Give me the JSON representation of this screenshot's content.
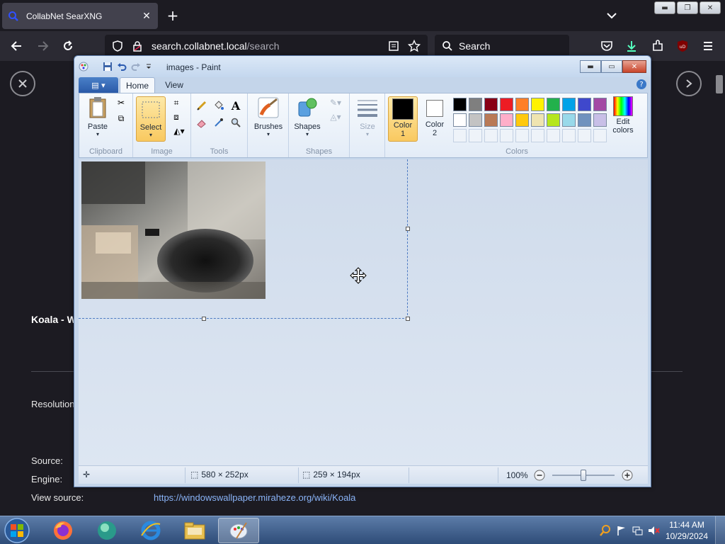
{
  "browser": {
    "tab_title": "CollabNet SearXNG",
    "url_domain": "search.collabnet.local",
    "url_path": "/search",
    "search_placeholder": "Search"
  },
  "page": {
    "result_title": "Koala - W",
    "resolution_label": "Resolution",
    "source_label": "Source:",
    "engine_label": "Engine:",
    "view_source_label": "View source:",
    "view_source_url": "https://windowswallpaper.miraheze.org/wiki/Koala"
  },
  "paint": {
    "title": "images - Paint",
    "tabs": [
      "Home",
      "View"
    ],
    "groups": {
      "clipboard": "Clipboard",
      "image": "Image",
      "tools": "Tools",
      "shapes": "Shapes",
      "colors": "Colors"
    },
    "buttons": {
      "paste": "Paste",
      "select": "Select",
      "brushes": "Brushes",
      "shapes": "Shapes",
      "size": "Size",
      "color1": "Color",
      "color1_num": "1",
      "color2": "Color",
      "color2_num": "2",
      "edit_colors_1": "Edit",
      "edit_colors_2": "colors"
    },
    "palette_row1": [
      "#000000",
      "#7f7f7f",
      "#880015",
      "#ed1c24",
      "#ff7f27",
      "#fff200",
      "#22b14c",
      "#00a2e8",
      "#3f48cc",
      "#a349a4"
    ],
    "palette_row2": [
      "#ffffff",
      "#c3c3c3",
      "#b97a57",
      "#ffaec9",
      "#ffc90e",
      "#efe4b0",
      "#b5e61d",
      "#99d9ea",
      "#7092be",
      "#c8bfe7"
    ],
    "status": {
      "selection_size": "580 × 252px",
      "image_size": "259 × 194px",
      "zoom": "100%"
    }
  },
  "taskbar": {
    "time": "11:44 AM",
    "date": "10/29/2024"
  }
}
